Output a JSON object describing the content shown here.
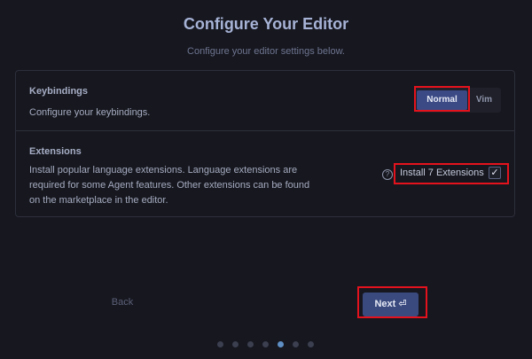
{
  "header": {
    "title": "Configure Your Editor",
    "subtitle": "Configure your editor settings below."
  },
  "keybindings": {
    "title": "Keybindings",
    "description": "Configure your keybindings.",
    "options": [
      "Normal",
      "Vim"
    ],
    "selected": "Normal"
  },
  "extensions": {
    "title": "Extensions",
    "description": "Install popular language extensions. Language extensions are required for some Agent features. Other extensions can be found on the marketplace in the editor.",
    "help_icon": "help-circle-icon",
    "install_label": "Install 7 Extensions",
    "checked": true,
    "check_glyph": "✓"
  },
  "navigation": {
    "back_label": "Back",
    "next_label": "Next ⏎",
    "steps_total": 7,
    "current_step": 5
  },
  "colors": {
    "background": "#16171f",
    "accent": "#3b4a85",
    "highlight": "#e4121d",
    "active_dot": "#5f8fc4"
  }
}
